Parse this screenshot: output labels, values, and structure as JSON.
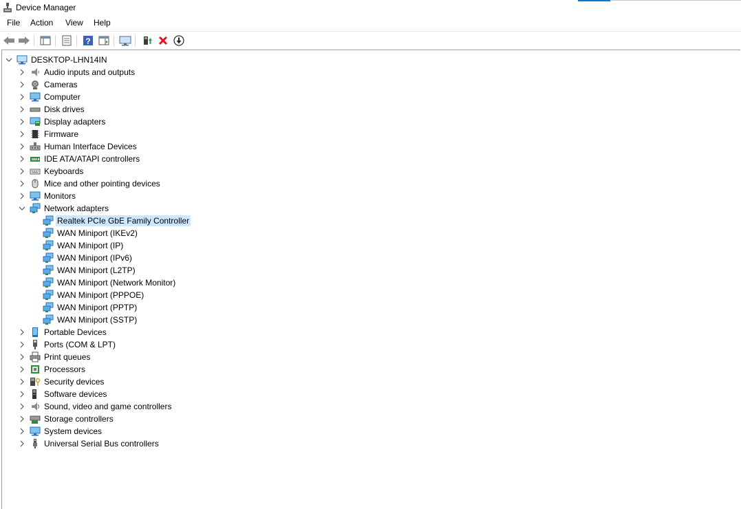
{
  "window": {
    "title": "Device Manager"
  },
  "menu": {
    "file": "File",
    "action": "Action",
    "view": "View",
    "help": "Help"
  },
  "toolbar": {
    "buttons": [
      "back-icon",
      "forward-icon",
      "properties-pane-icon",
      "properties-icon",
      "help-icon",
      "action-pane-icon",
      "scan-hardware-icon",
      "enable-device-icon",
      "uninstall-device-icon",
      "update-driver-icon"
    ]
  },
  "tree": {
    "root": "DESKTOP-LHN14IN",
    "categories": [
      {
        "label": "Audio inputs and outputs",
        "icon": "speaker-icon"
      },
      {
        "label": "Cameras",
        "icon": "camera-icon"
      },
      {
        "label": "Computer",
        "icon": "monitor-icon"
      },
      {
        "label": "Disk drives",
        "icon": "disk-drive-icon"
      },
      {
        "label": "Display adapters",
        "icon": "display-adapter-icon"
      },
      {
        "label": "Firmware",
        "icon": "firmware-chip-icon"
      },
      {
        "label": "Human Interface Devices",
        "icon": "hid-icon"
      },
      {
        "label": "IDE ATA/ATAPI controllers",
        "icon": "ide-controller-icon"
      },
      {
        "label": "Keyboards",
        "icon": "keyboard-icon"
      },
      {
        "label": "Mice and other pointing devices",
        "icon": "mouse-icon"
      },
      {
        "label": "Monitors",
        "icon": "monitor-icon"
      },
      {
        "label": "Network adapters",
        "icon": "network-icon"
      },
      {
        "label": "Portable Devices",
        "icon": "portable-device-icon"
      },
      {
        "label": "Ports (COM & LPT)",
        "icon": "port-icon"
      },
      {
        "label": "Print queues",
        "icon": "printer-icon"
      },
      {
        "label": "Processors",
        "icon": "processor-icon"
      },
      {
        "label": "Security devices",
        "icon": "security-device-icon"
      },
      {
        "label": "Software devices",
        "icon": "software-device-icon"
      },
      {
        "label": "Sound, video and game controllers",
        "icon": "sound-icon"
      },
      {
        "label": "Storage controllers",
        "icon": "storage-controller-icon"
      },
      {
        "label": "System devices",
        "icon": "system-device-icon"
      },
      {
        "label": "Universal Serial Bus controllers",
        "icon": "usb-icon"
      }
    ],
    "network_children": [
      "Realtek PCIe GbE Family Controller",
      "WAN Miniport (IKEv2)",
      "WAN Miniport (IP)",
      "WAN Miniport (IPv6)",
      "WAN Miniport (L2TP)",
      "WAN Miniport (Network Monitor)",
      "WAN Miniport (PPPOE)",
      "WAN Miniport (PPTP)",
      "WAN Miniport (SSTP)"
    ],
    "selected_child": "Realtek PCIe GbE Family Controller",
    "expanded_category": "Network adapters"
  },
  "colors": {
    "selection": "#cce8ff",
    "accent": "#0078d7",
    "delete": "#e81123"
  }
}
